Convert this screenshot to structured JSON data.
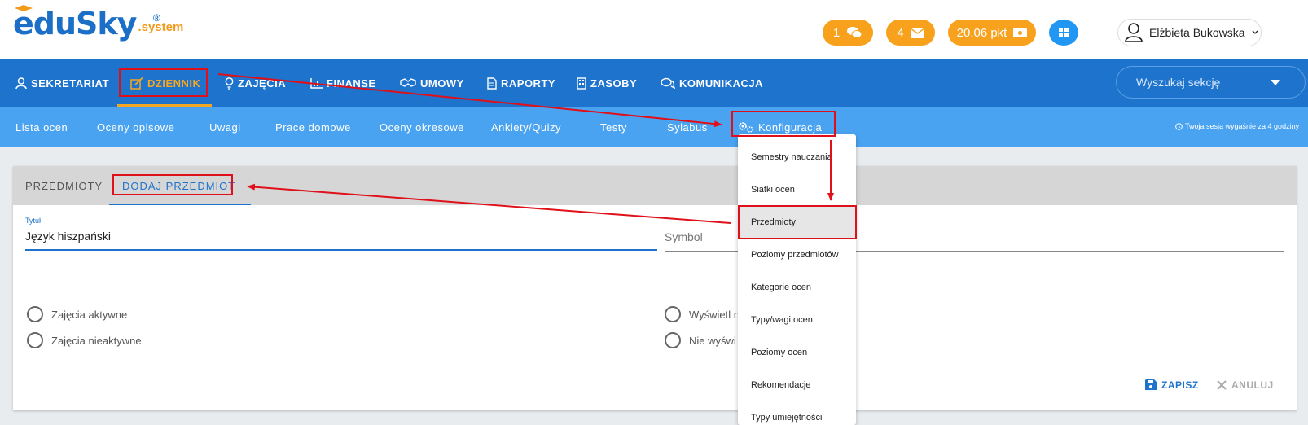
{
  "brand": {
    "name": "eduSky",
    "registered": "®",
    "suffix": ".system"
  },
  "header": {
    "chat_badge": "1",
    "mail_badge": "4",
    "points": "20.06 pkt",
    "user_name": "Elżbieta Bukowska"
  },
  "main_nav": {
    "items": [
      {
        "label": "SEKRETARIAT",
        "icon": "user-icon"
      },
      {
        "label": "DZIENNIK",
        "icon": "edit-icon",
        "active": true
      },
      {
        "label": "ZAJĘCIA",
        "icon": "bulb-icon"
      },
      {
        "label": "FINANSE",
        "icon": "chart-icon"
      },
      {
        "label": "UMOWY",
        "icon": "handshake-icon"
      },
      {
        "label": "RAPORTY",
        "icon": "document-icon"
      },
      {
        "label": "ZASOBY",
        "icon": "building-icon"
      },
      {
        "label": "KOMUNIKACJA",
        "icon": "chat-icon"
      }
    ],
    "search_placeholder": "Wyszukaj sekcję"
  },
  "sub_nav": {
    "items": [
      {
        "label": "Lista ocen"
      },
      {
        "label": "Oceny opisowe"
      },
      {
        "label": "Uwagi"
      },
      {
        "label": "Prace domowe"
      },
      {
        "label": "Oceny okresowe"
      },
      {
        "label": "Ankiety/Quizy"
      },
      {
        "label": "Testy"
      },
      {
        "label": "Sylabus"
      },
      {
        "label": "Konfiguracja",
        "icon": "gears-icon",
        "active": true
      }
    ],
    "session_note": "Twoja sesja wygaśnie za 4 godziny"
  },
  "card": {
    "tabs": [
      {
        "label": "PRZEDMIOTY"
      },
      {
        "label": "DODAJ PRZEDMIOT",
        "active": true
      }
    ],
    "title_label": "Tytuł",
    "title_value": "Język hiszpański",
    "symbol_placeholder": "Symbol",
    "radios_left": [
      "Zajęcia aktywne",
      "Zajęcia nieaktywne"
    ],
    "radios_right": [
      "Wyświetl n",
      "Nie wyświ"
    ],
    "save_label": "ZAPISZ",
    "cancel_label": "ANULUJ"
  },
  "dropdown": {
    "items": [
      {
        "label": "Semestry nauczania"
      },
      {
        "label": "Siatki ocen"
      },
      {
        "label": "Przedmioty",
        "highlighted": true
      },
      {
        "label": "Poziomy przedmiotów"
      },
      {
        "label": "Kategorie ocen"
      },
      {
        "label": "Typy/wagi ocen"
      },
      {
        "label": "Poziomy ocen"
      },
      {
        "label": "Rekomendacje"
      },
      {
        "label": "Typy umiejętności"
      }
    ]
  },
  "colors": {
    "primary": "#1e73cd",
    "subnav": "#4aa3f0",
    "accent": "#f5a623",
    "annotation": "#e0101a"
  }
}
